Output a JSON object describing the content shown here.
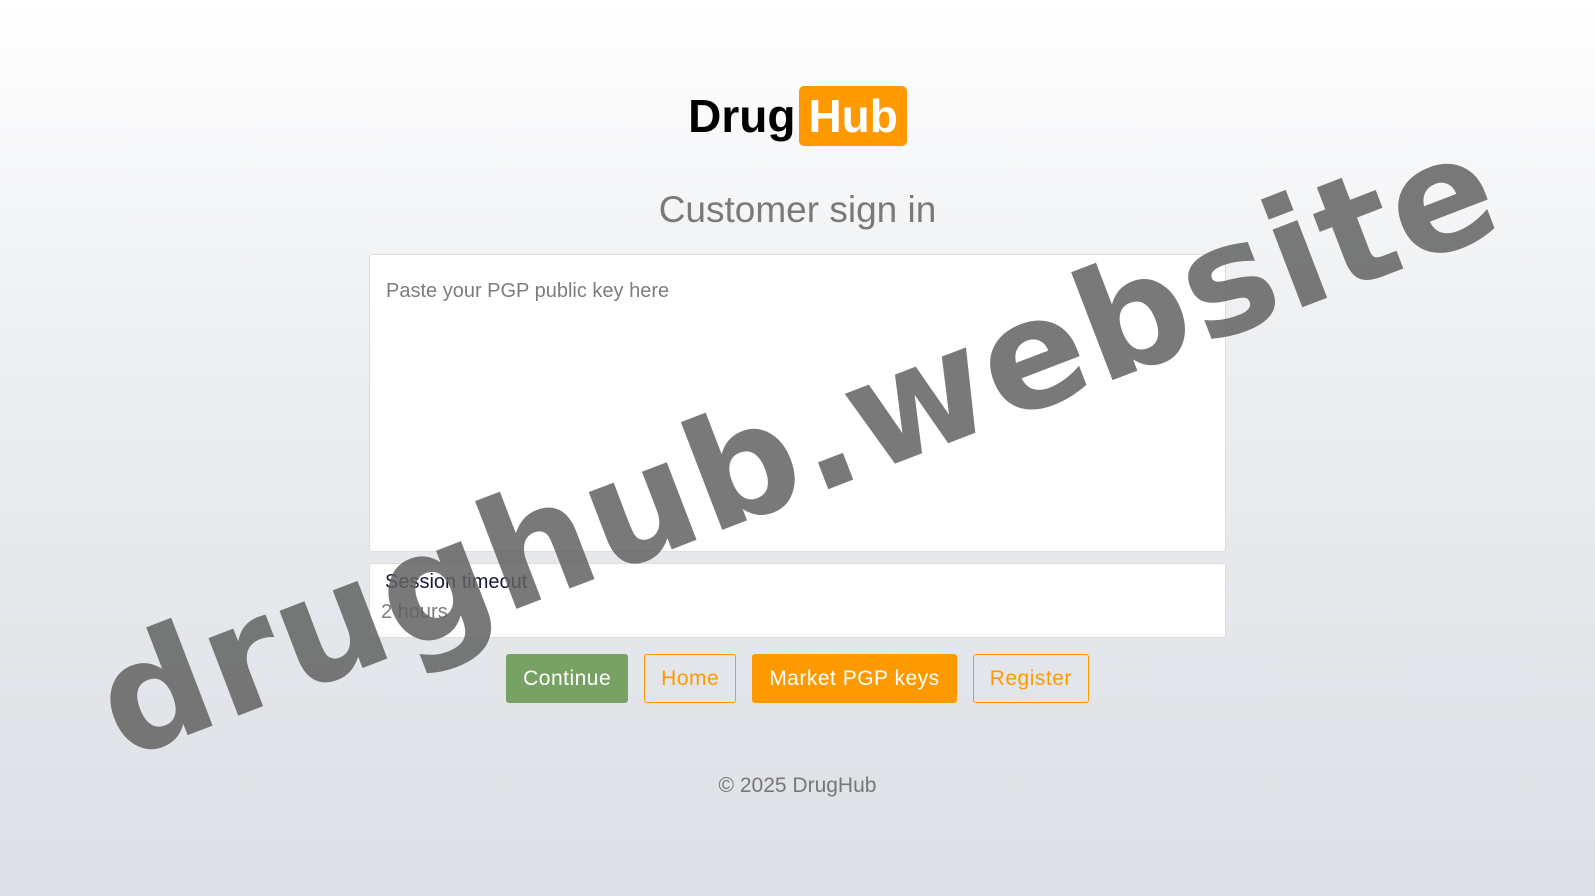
{
  "logo": {
    "part1": "Drug",
    "part2": "Hub"
  },
  "page_title": "Customer sign in",
  "pgp_key": {
    "placeholder": "Paste your PGP public key here",
    "value": ""
  },
  "session_timeout": {
    "label": "Session timeout",
    "value": "2 hours"
  },
  "buttons": {
    "continue": "Continue",
    "home": "Home",
    "market_pgp_keys": "Market PGP keys",
    "register": "Register"
  },
  "footer": "© 2025 DrugHub",
  "watermark": "drughub.website",
  "colors": {
    "accent": "#ff9900",
    "continue": "#78a263"
  }
}
